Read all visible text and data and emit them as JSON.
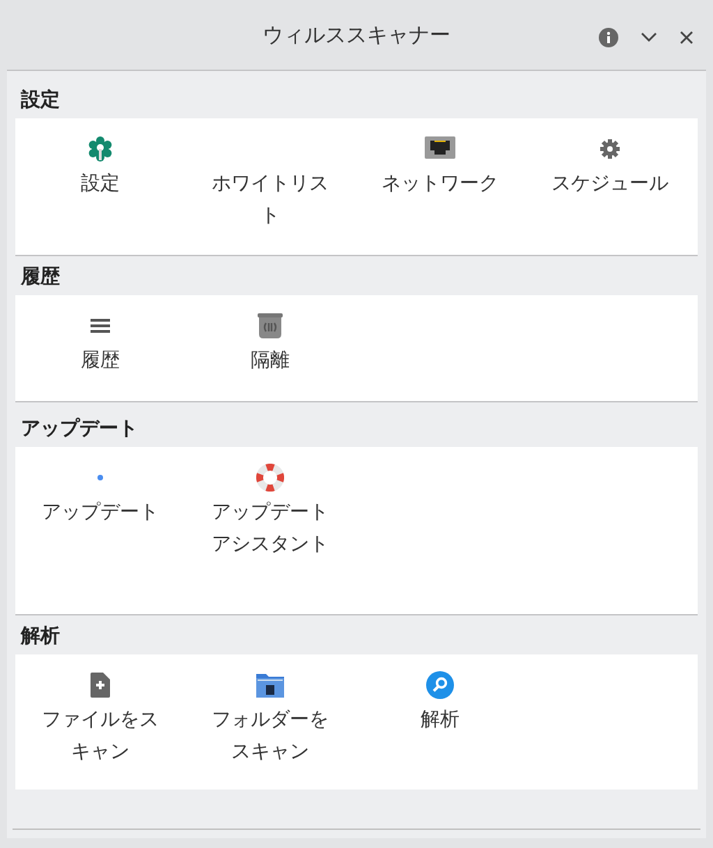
{
  "window": {
    "title": "ウィルススキャナー"
  },
  "sections": [
    {
      "title": "設定",
      "items": [
        {
          "label": "設定"
        },
        {
          "label": "ホワイトリスト"
        },
        {
          "label": "ネットワーク"
        },
        {
          "label": "スケジュール"
        }
      ]
    },
    {
      "title": "履歴",
      "items": [
        {
          "label": "履歴"
        },
        {
          "label": "隔離"
        }
      ]
    },
    {
      "title": "アップデート",
      "items": [
        {
          "label": "アップデート"
        },
        {
          "label": "アップデートアシスタント"
        }
      ]
    },
    {
      "title": "解析",
      "items": [
        {
          "label": "ファイルをスキャン"
        },
        {
          "label": "フォルダーをスキャン"
        },
        {
          "label": "解析"
        }
      ]
    }
  ]
}
